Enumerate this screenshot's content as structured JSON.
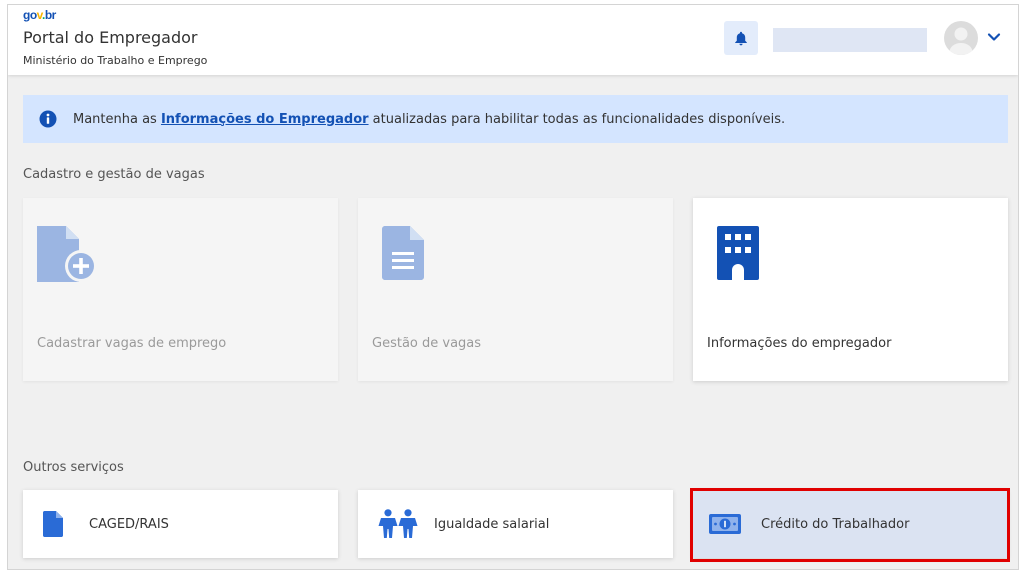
{
  "header": {
    "logo": {
      "g1": "go",
      "g2": "v",
      "g3": ".",
      "g4": "br"
    },
    "portal_title": "Portal do Empregador",
    "ministry": "Ministério do Trabalho e Emprego",
    "icons": {
      "bell": "bell-icon",
      "avatar": "user-avatar-icon",
      "chevron": "chevron-down-icon"
    }
  },
  "alert": {
    "icon": "info-icon",
    "text_before": "Mantenha as ",
    "link_text": "Informações do Empregador",
    "text_after": " atualizadas para habilitar todas as funcionalidades disponíveis."
  },
  "sections": {
    "cadastro": {
      "title": "Cadastro e gestão de vagas",
      "cards": [
        {
          "label": "Cadastrar vagas de emprego",
          "icon": "file-add-icon",
          "enabled": false
        },
        {
          "label": "Gestão de vagas",
          "icon": "file-text-icon",
          "enabled": false
        },
        {
          "label": "Informações do empregador",
          "icon": "building-icon",
          "enabled": true
        }
      ]
    },
    "outros": {
      "title": "Outros serviços",
      "services": [
        {
          "label": "CAGED/RAIS",
          "icon": "file-icon"
        },
        {
          "label": "Igualdade salarial",
          "icon": "people-icon"
        },
        {
          "label": "Crédito do Trabalhador",
          "icon": "money-bill-icon",
          "highlighted": true
        }
      ]
    }
  },
  "colors": {
    "primary": "#1351b4",
    "alert_bg": "#d4e5ff",
    "disabled_icon": "#9bb5e2",
    "highlight_bg": "#dbe3f2",
    "highlight_border": "#e00000"
  }
}
